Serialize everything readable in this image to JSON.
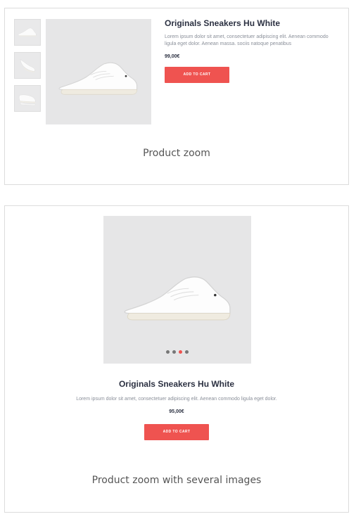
{
  "zoom_card": {
    "title": "Originals Sneakers Hu White",
    "description": "Lorem ipsum dolor sit amet, consectetuer adipiscing elit. Aenean commodo ligula eget dolor. Aenean massa. sociis natoque penatibus",
    "price": "99,00€",
    "cart_label": "ADD TO CART",
    "caption": "Product zoom",
    "thumbnails": [
      "shoe-side-thumb",
      "shoe-angle-thumb",
      "shoe-pair-thumb"
    ]
  },
  "gallery_card": {
    "title": "Originals Sneakers Hu White",
    "description": "Lorem ipsum dolor sit amet, consectetuer adipiscing elit. Aenean commodo ligula eget dolor.",
    "price": "95,00€",
    "cart_label": "ADD TO CART",
    "caption": "Product zoom with several images",
    "dots_total": 4,
    "dots_active_index": 2
  },
  "colors": {
    "accent": "#ef5350",
    "title": "#2c3142",
    "image_bg": "#e6e6e7"
  }
}
